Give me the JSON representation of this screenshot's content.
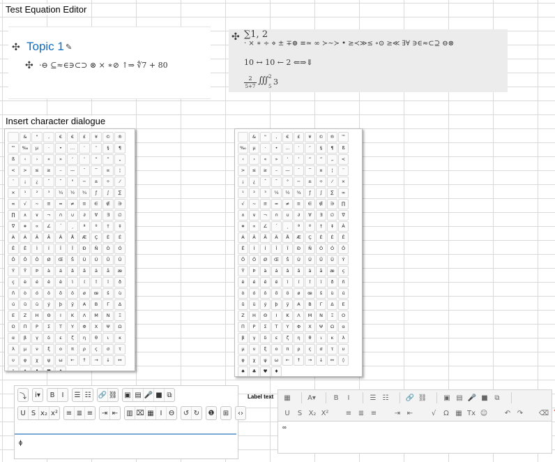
{
  "sheet": {
    "label_equation": "Test Equation Editor",
    "label_dialog": "Insert character dialogue",
    "label_text": "Label text"
  },
  "topic": {
    "title": "Topic 1",
    "equation": "·⊖ ⊆≈∈∋⊂⊃ ⊗ × ∗⊘ ↑⇒ ∜7 + 80"
  },
  "equation_panel": {
    "line1": "∑1, 2",
    "line2": "· × ∗ ÷ ⋄ ± ∓⊕ ≡≃ ∞ ≻∼≻ • ≥≺≫≤ ∘⊙ ≥≪ ∃∀ ∋∈≈⊂⊇ ⊖⊗",
    "line3": "10 ↔ 10 ← 2 ⇐⇒⇓",
    "frac_num": "2",
    "frac_den": "5+7",
    "line4": "∭",
    "line4_sup": "2",
    "line4_sub": "5",
    "line4_tail": "3"
  },
  "dialog_left": {
    "chars": [
      "",
      "&",
      "\"",
      "‚",
      "€",
      "€",
      "£",
      "¥",
      "©",
      "®",
      "™",
      "‰",
      "µ",
      "·",
      "•",
      "…",
      "′",
      "″",
      "§",
      "¶",
      "ß",
      "‹",
      "›",
      "«",
      "»",
      "‘",
      "’",
      "“",
      "”",
      "„",
      "<",
      ">",
      "≤",
      "≥",
      "–",
      "—",
      "¯",
      "‾",
      "¤",
      "¦",
      "¨",
      "¡",
      "¿",
      "ˆ",
      "˜",
      "°",
      "−",
      "±",
      "÷",
      "⁄",
      "×",
      "¹",
      "²",
      "³",
      "¼",
      "½",
      "¾",
      "ƒ",
      "∫",
      "∑",
      "∞",
      "√",
      "∼",
      "≅",
      "≈",
      "≠",
      "≡",
      "∈",
      "∉",
      "∋",
      "∏",
      "∧",
      "∨",
      "¬",
      "∩",
      "∪",
      "∂",
      "∀",
      "∃",
      "∅",
      "∇",
      "∗",
      "∝",
      "∠",
      "´",
      "¸",
      "ª",
      "º",
      "†",
      "‡",
      "À",
      "Á",
      "Â",
      "Ã",
      "Ä",
      "Å",
      "Æ",
      "Ç",
      "È",
      "É",
      "Ê",
      "Ë",
      "Ì",
      "Í",
      "Î",
      "Ï",
      "Ð",
      "Ñ",
      "Ò",
      "Ó",
      "Ô",
      "Õ",
      "Ö",
      "Ø",
      "Œ",
      "Š",
      "Ù",
      "Ú",
      "Û",
      "Ü",
      "Ý",
      "Ÿ",
      "Þ",
      "à",
      "á",
      "â",
      "ã",
      "ä",
      "å",
      "æ",
      "ç",
      "è",
      "é",
      "ê",
      "ë",
      "ì",
      "í",
      "î",
      "ï",
      "ð",
      "ñ",
      "ò",
      "ó",
      "ô",
      "õ",
      "ö",
      "ø",
      "œ",
      "š",
      "ù",
      "ú",
      "û",
      "ü",
      "ý",
      "þ",
      "ÿ",
      "Α",
      "Β",
      "Γ",
      "Δ",
      "Ε",
      "Ζ",
      "Η",
      "Θ",
      "Ι",
      "Κ",
      "Λ",
      "Μ",
      "Ν",
      "Ξ",
      "Ο",
      "Π",
      "Ρ",
      "Σ",
      "Τ",
      "Υ",
      "Φ",
      "Χ",
      "Ψ",
      "Ω",
      "α",
      "β",
      "γ",
      "δ",
      "ε",
      "ζ",
      "η",
      "θ",
      "ι",
      "κ",
      "λ",
      "μ",
      "ν",
      "ξ",
      "ο",
      "π",
      "ρ",
      "ς",
      "σ",
      "τ",
      "υ",
      "φ",
      "χ",
      "ψ",
      "ω",
      "←",
      "↑",
      "→",
      "↓",
      "↔",
      "◊",
      "♠",
      "♣",
      "♥",
      "♦"
    ]
  },
  "dialog_right": {
    "chars": [
      "",
      "&",
      "\"",
      "‚",
      "€",
      "£",
      "¥",
      "©",
      "®",
      "™",
      "‰",
      "µ",
      "·",
      "•",
      "…",
      "′",
      "″",
      "§",
      "¶",
      "ß",
      "‹",
      "›",
      "«",
      "»",
      "‘",
      "’",
      "“",
      "”",
      "„",
      "<",
      ">",
      "≤",
      "≥",
      "–",
      "—",
      "¯",
      "‾",
      "¤",
      "¦",
      "¨",
      "¡",
      "¿",
      "ˆ",
      "˜",
      "°",
      "−",
      "±",
      "÷",
      "⁄",
      "×",
      "¹",
      "²",
      "³",
      "¼",
      "½",
      "¾",
      "ƒ",
      "∫",
      "∑",
      "∞",
      "√",
      "∼",
      "≅",
      "≈",
      "≠",
      "≡",
      "∈",
      "∉",
      "∋",
      "∏",
      "∧",
      "∨",
      "¬",
      "∩",
      "∪",
      "∂",
      "∀",
      "∃",
      "∅",
      "∇",
      "∗",
      "∝",
      "∠",
      "´",
      "¸",
      "ª",
      "º",
      "†",
      "‡",
      "À",
      "Á",
      "Â",
      "Ã",
      "Ä",
      "Å",
      "Æ",
      "Ç",
      "È",
      "É",
      "Ê",
      "Ë",
      "Ì",
      "Í",
      "Î",
      "Ï",
      "Ð",
      "Ñ",
      "Ò",
      "Ó",
      "Ô",
      "Õ",
      "Ö",
      "Ø",
      "Œ",
      "Š",
      "Ù",
      "Ú",
      "Û",
      "Ü",
      "Ý",
      "Ÿ",
      "Þ",
      "à",
      "á",
      "â",
      "ã",
      "ä",
      "å",
      "æ",
      "ç",
      "è",
      "é",
      "ê",
      "ë",
      "ì",
      "í",
      "î",
      "ï",
      "ð",
      "ñ",
      "ò",
      "ó",
      "ô",
      "õ",
      "ö",
      "ø",
      "œ",
      "š",
      "ù",
      "ú",
      "û",
      "ü",
      "ý",
      "þ",
      "ÿ",
      "Α",
      "Β",
      "Γ",
      "Δ",
      "Ε",
      "Ζ",
      "Η",
      "Θ",
      "Ι",
      "Κ",
      "Λ",
      "Μ",
      "Ν",
      "Ξ",
      "Ο",
      "Π",
      "Ρ",
      "Σ",
      "Τ",
      "Υ",
      "Φ",
      "Χ",
      "Ψ",
      "Ω",
      "α",
      "β",
      "γ",
      "δ",
      "ε",
      "ζ",
      "η",
      "θ",
      "ι",
      "κ",
      "λ",
      "μ",
      "ν",
      "ξ",
      "ο",
      "π",
      "ρ",
      "ς",
      "σ",
      "τ",
      "υ",
      "φ",
      "χ",
      "ψ",
      "ω",
      "←",
      "↑",
      "→",
      "↓",
      "↔",
      "◊",
      "♠",
      "♣",
      "♥",
      "♦"
    ]
  },
  "atto_toolbar": {
    "row1": [
      [
        "⤵"
      ],
      [
        "i▾"
      ],
      [
        "B",
        "I"
      ],
      [
        "☰",
        "☷"
      ],
      [
        "🔗",
        "⛓"
      ],
      [
        "▣",
        "▤",
        "🎤",
        "■",
        "⧉"
      ]
    ],
    "row2": [
      [
        "U",
        "S",
        "x₂",
        "x²"
      ],
      [
        "≡",
        "≣",
        "≡"
      ],
      [
        "⇥",
        "⇤"
      ],
      [
        "▥",
        "⌧",
        "▦",
        "I",
        "Θ"
      ],
      [
        "↺",
        "↻"
      ],
      [
        "❶"
      ],
      [
        "⊞"
      ],
      [
        "‹›"
      ]
    ],
    "content": "ɸ"
  },
  "ck_toolbar": {
    "row1": [
      [
        "▦"
      ],
      [
        "A▾"
      ],
      [
        "B",
        "I"
      ],
      [
        "☰",
        "☷"
      ],
      [
        "🔗",
        "⛓"
      ],
      [
        "▣",
        "▤",
        "🎤",
        "■",
        "⧉"
      ]
    ],
    "row2": [
      [
        "U",
        "S",
        "X₂",
        "X²"
      ],
      [
        "≡",
        "≣",
        "≡"
      ],
      [
        "⇥",
        "⇤"
      ],
      [
        "√",
        "Ω",
        "▦",
        "Tx",
        "☺"
      ],
      [
        "↶",
        "↷"
      ],
      [
        "⌫",
        "❓",
        "‹›"
      ]
    ],
    "content": "∞"
  }
}
